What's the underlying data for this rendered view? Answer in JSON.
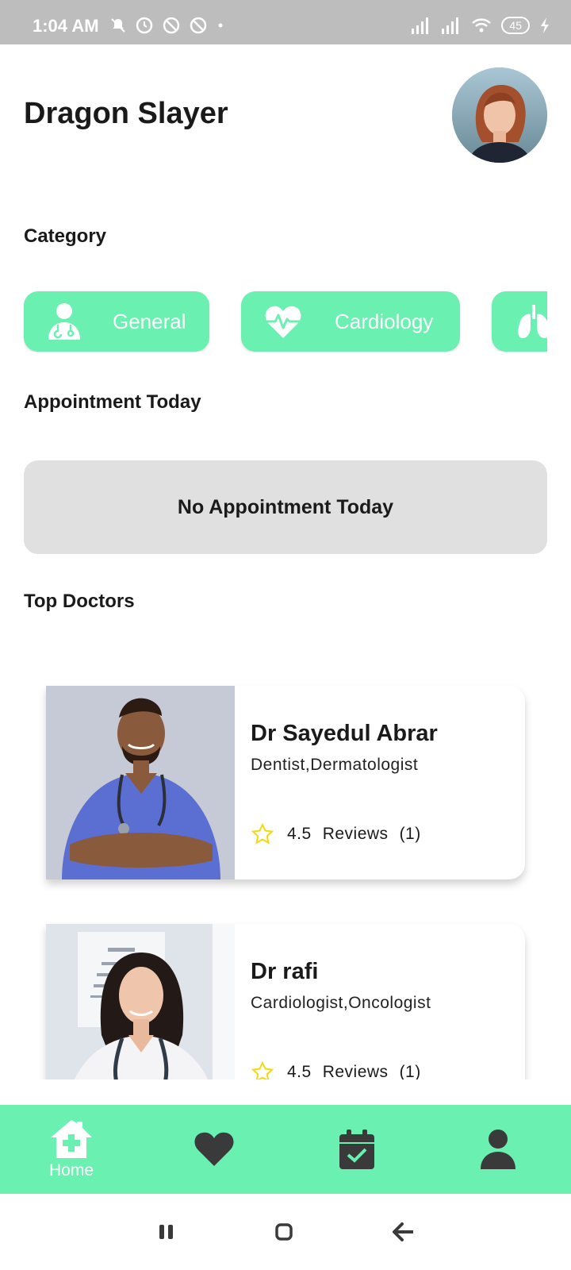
{
  "status_bar": {
    "time": "1:04 AM",
    "battery": "45"
  },
  "header": {
    "user_name": "Dragon Slayer"
  },
  "sections": {
    "category": "Category",
    "appointment_today": "Appointment Today",
    "top_doctors": "Top Doctors"
  },
  "categories": [
    {
      "label": "General",
      "icon": "doctor-icon"
    },
    {
      "label": "Cardiology",
      "icon": "heart-pulse-icon"
    },
    {
      "label": "",
      "icon": "lungs-icon"
    }
  ],
  "appointment": {
    "empty_text": "No Appointment Today"
  },
  "doctors": [
    {
      "name": "Dr Sayedul Abrar",
      "specialty": "Dentist,Dermatologist",
      "rating": "4.5",
      "reviews_label": "Reviews",
      "reviews_count": "(1)"
    },
    {
      "name": "Dr rafi",
      "specialty": "Cardiologist,Oncologist",
      "rating": "4.5",
      "reviews_label": "Reviews",
      "reviews_count": "(1)"
    }
  ],
  "bottom_nav": {
    "home_label": "Home",
    "items": [
      "home-icon",
      "heart-icon",
      "calendar-check-icon",
      "person-icon"
    ]
  },
  "colors": {
    "accent": "#6af0b0",
    "card_gray": "#e0e0e0",
    "star": "#f5d90a",
    "icon_dark": "#3a3a3a"
  }
}
